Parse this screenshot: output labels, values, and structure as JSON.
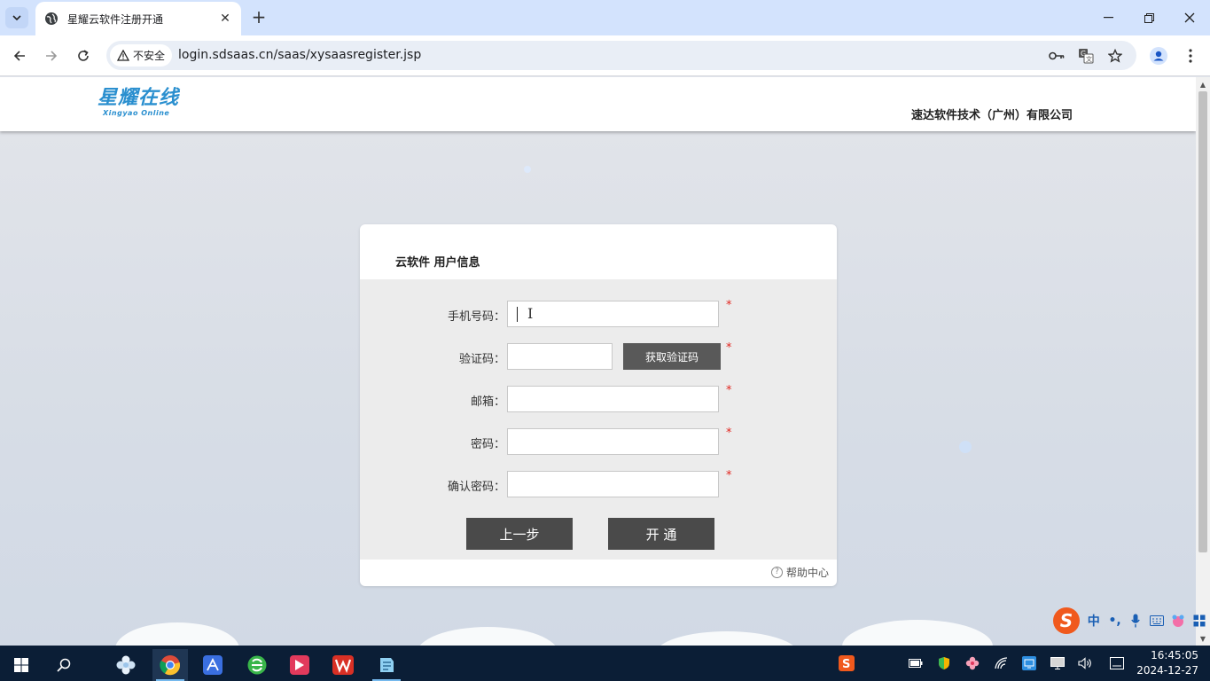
{
  "browser": {
    "tab_title": "星耀云软件注册开通",
    "security_label": "不安全",
    "url": "login.sdsaas.cn/saas/xysaasregister.jsp"
  },
  "site": {
    "logo_main": "星耀在线",
    "logo_sub": "Xingyao Online",
    "company": "速达软件技术（广州）有限公司"
  },
  "form": {
    "title": "云软件 用户信息",
    "phone_label": "手机号码：",
    "code_label": "验证码：",
    "get_code_label": "获取验证码",
    "email_label": "邮箱：",
    "password_label": "密码：",
    "confirm_label": "确认密码：",
    "required_mark": "*",
    "prev_label": "上一步",
    "submit_label": "开 通",
    "help_label": "帮助中心",
    "help_glyph": "?"
  },
  "ime": {
    "logo": "S",
    "mode": "中",
    "punct": "•,"
  },
  "taskbar": {
    "time": "16:45:05",
    "date": "2024-12-27"
  }
}
